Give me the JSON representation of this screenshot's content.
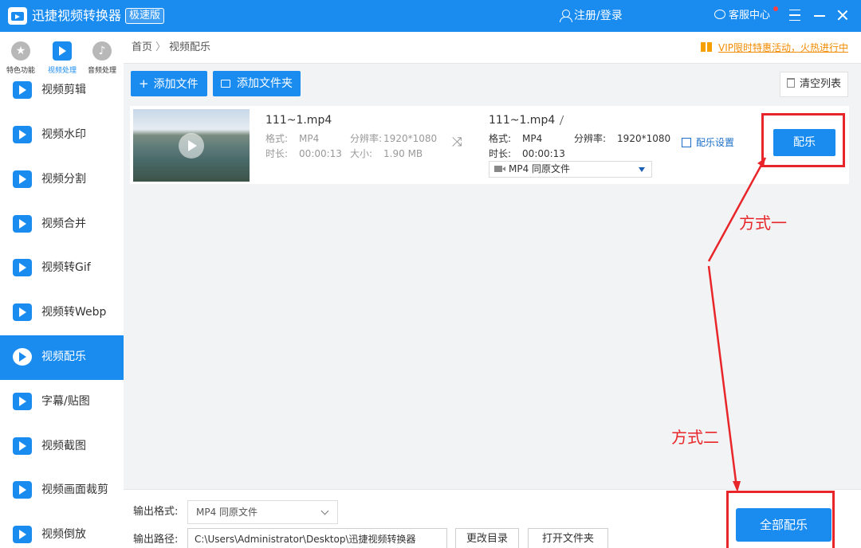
{
  "titlebar": {
    "app_title": "迅捷视频转换器",
    "edition": "极速版",
    "login": "注册/登录",
    "service": "客服中心"
  },
  "sidebar": {
    "categories": [
      {
        "label": "特色功能",
        "icon": "star-icon"
      },
      {
        "label": "视频处理",
        "icon": "film-icon"
      },
      {
        "label": "音频处理",
        "icon": "music-icon"
      }
    ],
    "items": [
      {
        "label": "视频剪辑"
      },
      {
        "label": "视频水印"
      },
      {
        "label": "视频分割"
      },
      {
        "label": "视频合并"
      },
      {
        "label": "视频转Gif"
      },
      {
        "label": "视频转Webp"
      },
      {
        "label": "视频配乐",
        "active": true
      },
      {
        "label": "字幕/贴图"
      },
      {
        "label": "视频截图"
      },
      {
        "label": "视频画面裁剪"
      },
      {
        "label": "视频倒放"
      }
    ]
  },
  "breadcrumb": {
    "home": "首页",
    "sep": "〉",
    "current": "视频配乐"
  },
  "vip": "VIP限时特惠活动，火热进行中",
  "toolbar": {
    "add_file": "添加文件",
    "add_folder": "添加文件夹",
    "clear_list": "清空列表"
  },
  "file": {
    "src_name": "111~1.mp4",
    "format_label": "格式:",
    "format": "MP4",
    "resolution_label": "分辨率:",
    "resolution": "1920*1080",
    "duration_label": "时长:",
    "duration": "00:00:13",
    "size_label": "大小:",
    "size": "1.90 MB",
    "out_name": "111~1.mp4",
    "out_format": "MP4",
    "out_resolution": "1920*1080",
    "out_duration": "00:00:13",
    "out_select": "MP4  同原文件",
    "music_settings": "配乐设置",
    "music_button": "配乐"
  },
  "bottom": {
    "output_format_label": "输出格式:",
    "output_format": "MP4  同原文件",
    "output_path_label": "输出路径:",
    "output_path": "C:\\Users\\Administrator\\Desktop\\迅捷视频转换器",
    "change_dir": "更改目录",
    "open_folder": "打开文件夹",
    "all_music": "全部配乐"
  },
  "annotations": {
    "method1": "方式一",
    "method2": "方式二",
    "color": "#e8262a"
  },
  "colors": {
    "accent": "#1a8cf0"
  }
}
